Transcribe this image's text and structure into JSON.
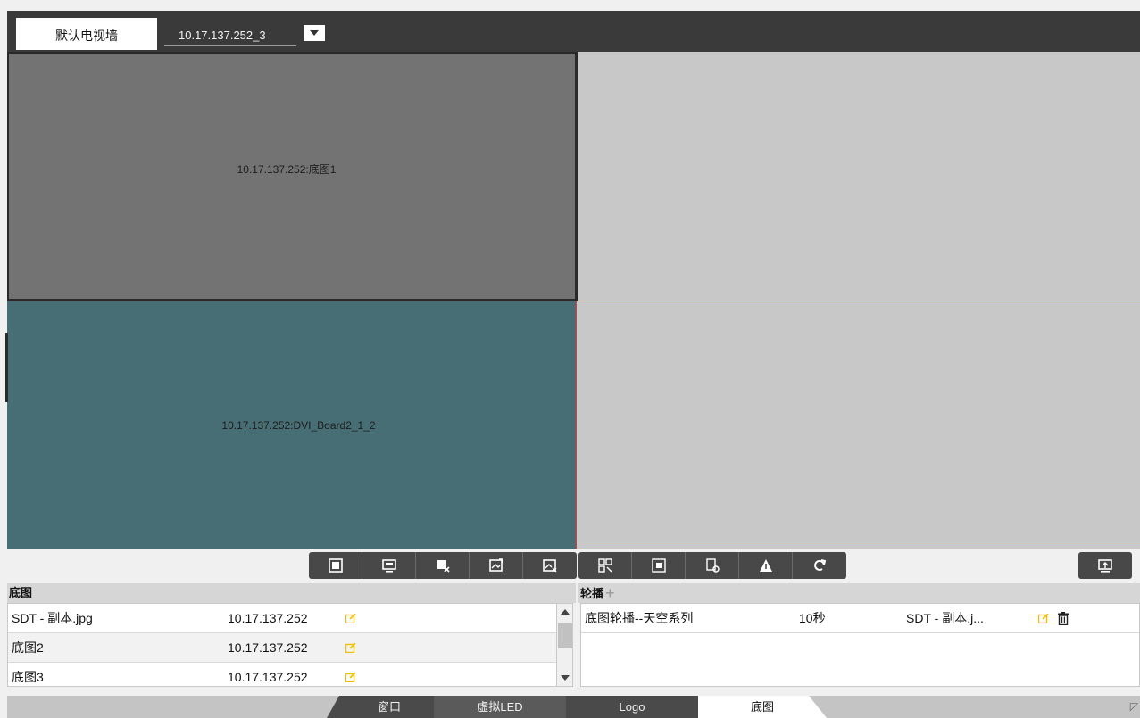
{
  "header": {
    "wall_tab": "默认电视墙",
    "wall_name": "10.17.137.252_3"
  },
  "wall": {
    "cells": [
      {
        "label": "10.17.137.252:底图1",
        "color": "#737373"
      },
      {
        "label": "",
        "color": "#c8c8c8"
      },
      {
        "label": "10.17.137.252:DVI_Board2_1_2",
        "color": "#486e75"
      },
      {
        "label": "",
        "color": "#c8c8c8"
      }
    ],
    "selected_outline_color": "#e53935"
  },
  "toolbar": {
    "group1": [
      "play-window-icon",
      "monitor-icon",
      "close-window-icon",
      "image-export-icon",
      "image-remove-icon"
    ],
    "group2": [
      "split-screen-icon",
      "fullscreen-icon",
      "clear-icon",
      "warning-icon",
      "refresh-icon"
    ],
    "right": "upload-icon"
  },
  "background_images": {
    "title": "底图",
    "rows": [
      {
        "name": "SDT  - 副本.jpg",
        "ip": "10.17.137.252"
      },
      {
        "name": "底图2",
        "ip": "10.17.137.252"
      },
      {
        "name": "底图3",
        "ip": "10.17.137.252"
      }
    ]
  },
  "carousel": {
    "title": "轮播",
    "add": "+",
    "rows": [
      {
        "name": "底图轮播--天空系列",
        "interval": "10秒",
        "image": "SDT  - 副本.j..."
      }
    ]
  },
  "tabs": {
    "window": "窗口",
    "virtual_led": "虚拟LED",
    "logo": "Logo",
    "background": "底图",
    "active": "底图"
  },
  "colors": {
    "edit_icon": "#f0c000",
    "toolbar_bg": "#484848"
  }
}
